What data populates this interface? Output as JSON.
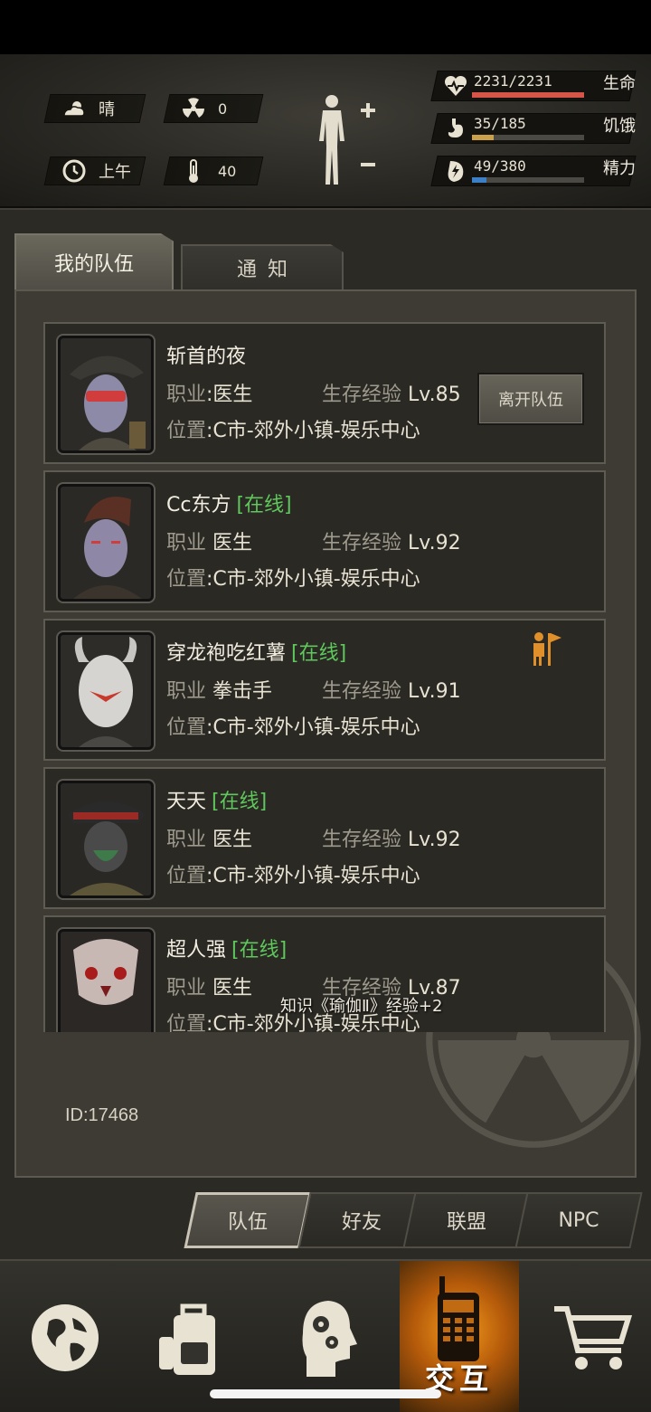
{
  "status": {
    "weather": "晴",
    "radiation": "0",
    "time_of_day": "上午",
    "temperature": "40"
  },
  "vitals": [
    {
      "icon": "heart-icon",
      "value": "2231/2231",
      "label": "生命",
      "fill": 1.0,
      "color": "#d65448"
    },
    {
      "icon": "stomach-icon",
      "value": "35/185",
      "label": "饥饿",
      "fill": 0.19,
      "color": "#caa04a"
    },
    {
      "icon": "energy-icon",
      "value": "49/380",
      "label": "精力",
      "fill": 0.13,
      "color": "#3c7fc4"
    }
  ],
  "tabs": {
    "my_team": "我的队伍",
    "notice": "通知"
  },
  "team": [
    {
      "name": "斩首的夜",
      "online": "",
      "job_label": "职业",
      "job": ":医生",
      "exp_label": "生存经验",
      "level": "Lv.85",
      "loc_label": "位置",
      "location": ":C市-郊外小镇-娱乐中心",
      "action": "离开队伍",
      "leader": false
    },
    {
      "name": "Cc东方",
      "online": "[在线]",
      "job_label": "职业",
      "job": "医生",
      "exp_label": "生存经验",
      "level": "Lv.92",
      "loc_label": "位置",
      "location": ":C市-郊外小镇-娱乐中心",
      "action": "",
      "leader": false
    },
    {
      "name": "穿龙袍吃红薯",
      "online": "[在线]",
      "job_label": "职业",
      "job": "拳击手",
      "exp_label": "生存经验",
      "level": "Lv.91",
      "loc_label": "位置",
      "location": ":C市-郊外小镇-娱乐中心",
      "action": "",
      "leader": true
    },
    {
      "name": "天天",
      "online": "[在线]",
      "job_label": "职业",
      "job": "医生",
      "exp_label": "生存经验",
      "level": "Lv.92",
      "loc_label": "位置",
      "location": ":C市-郊外小镇-娱乐中心",
      "action": "",
      "leader": false
    },
    {
      "name": "超人强",
      "online": "[在线]",
      "job_label": "职业",
      "job": "医生",
      "exp_label": "生存经验",
      "level": "Lv.87",
      "loc_label": "位置",
      "location": ":C市-郊外小镇-娱乐中心",
      "action": "",
      "leader": false
    }
  ],
  "toast": "知识《瑜伽Ⅱ》经验+2",
  "player_id": "ID:17468",
  "subtabs": [
    "队伍",
    "好友",
    "联盟",
    "NPC"
  ],
  "nav": {
    "interact_label": "交互"
  }
}
